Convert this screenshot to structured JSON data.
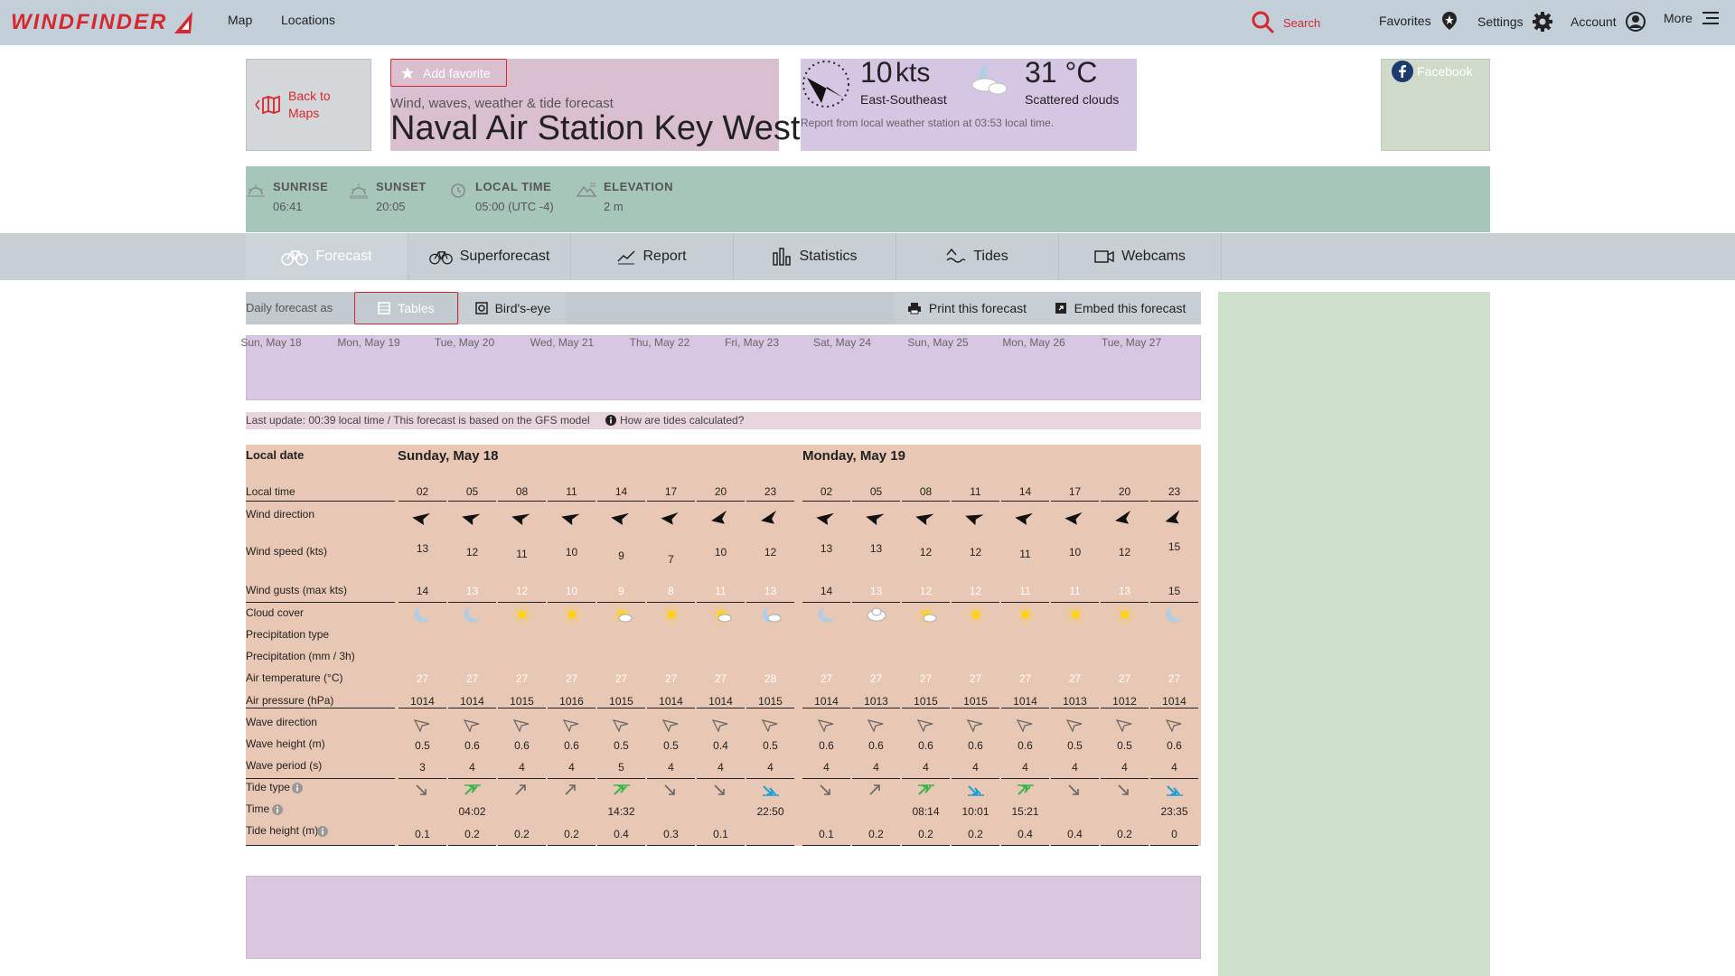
{
  "nav": {
    "logo": "WINDFINDER",
    "links": [
      "Map",
      "Locations"
    ],
    "search": "Search",
    "favorites": "Favorites",
    "settings": "Settings",
    "account": "Account",
    "more": "More"
  },
  "header": {
    "back": "Back to Maps",
    "add_favorite": "Add favorite",
    "subtitle": "Wind, waves, weather & tide forecast",
    "spot_name": "Naval Air Station Key West",
    "wind_value": "10",
    "wind_unit": "kts",
    "wind_dir": "East-Southeast",
    "temp": "31 °C",
    "cloud": "Scattered clouds",
    "report_note": "Report from local weather station at 03:53 local time.",
    "facebook": "Facebook"
  },
  "info": {
    "sunrise_label": "SUNRISE",
    "sunrise": "06:41",
    "sunset_label": "SUNSET",
    "sunset": "20:05",
    "localtime_label": "LOCAL TIME",
    "localtime": "05:00 (UTC -4)",
    "elevation_label": "ELEVATION",
    "elevation": "2 m"
  },
  "tabs": [
    "Forecast",
    "Superforecast",
    "Report",
    "Statistics",
    "Tides",
    "Webcams"
  ],
  "toolbar": {
    "daily_as": "Daily forecast as",
    "tables": "Tables",
    "birdseye": "Bird's-eye",
    "print": "Print this forecast",
    "embed": "Embed this forecast"
  },
  "days": [
    "Sun, May 18",
    "Mon, May 19",
    "Tue, May 20",
    "Wed, May 21",
    "Thu, May 22",
    "Fri, May 23",
    "Sat, May 24",
    "Sun, May 25",
    "Mon, May 26",
    "Tue, May 27"
  ],
  "note": {
    "last_update": "Last update: 00:39 local time / This forecast is based on the GFS model",
    "tides_calc": "How are tides calculated?"
  },
  "table": {
    "row_labels": {
      "local_date": "Local date",
      "local_time": "Local time",
      "wind_direction": "Wind direction",
      "wind_speed": "Wind speed (kts)",
      "wind_gusts": "Wind gusts (max kts)",
      "cloud_cover": "Cloud cover",
      "precip_type": "Precipitation type",
      "precip": "Precipitation (mm / 3h)",
      "air_temp": "Air temperature (°C)",
      "air_pressure": "Air pressure (hPa)",
      "wave_direction": "Wave direction",
      "wave_height": "Wave height (m)",
      "wave_period": "Wave period (s)",
      "tide_type": "Tide type",
      "tide_time": "Time",
      "tide_height": "Tide height (m)"
    },
    "day_titles": [
      "Sunday, May 18",
      "Monday, May 19"
    ],
    "times": [
      "02",
      "05",
      "08",
      "11",
      "14",
      "17",
      "20",
      "23",
      "02",
      "05",
      "08",
      "11",
      "14",
      "17",
      "20",
      "23"
    ],
    "wind_speed": [
      "13",
      "12",
      "11",
      "10",
      "9",
      "7",
      "10",
      "12",
      "13",
      "13",
      "12",
      "12",
      "11",
      "10",
      "12",
      "15"
    ],
    "wind_gusts": [
      "14",
      "13",
      "12",
      "10",
      "9",
      "8",
      "11",
      "13",
      "14",
      "13",
      "12",
      "12",
      "11",
      "11",
      "13",
      "15"
    ],
    "air_temp": [
      "27",
      "27",
      "27",
      "27",
      "27",
      "27",
      "27",
      "28",
      "27",
      "27",
      "27",
      "27",
      "27",
      "27",
      "27",
      "27"
    ],
    "air_pressure": [
      "1014",
      "1014",
      "1015",
      "1016",
      "1015",
      "1014",
      "1014",
      "1015",
      "1014",
      "1013",
      "1015",
      "1015",
      "1014",
      "1013",
      "1012",
      "1014"
    ],
    "wave_height": [
      "0.5",
      "0.6",
      "0.6",
      "0.6",
      "0.5",
      "0.5",
      "0.4",
      "0.5",
      "0.6",
      "0.6",
      "0.6",
      "0.6",
      "0.6",
      "0.5",
      "0.5",
      "0.6"
    ],
    "wave_period": [
      "3",
      "4",
      "4",
      "4",
      "5",
      "4",
      "4",
      "4",
      "4",
      "4",
      "4",
      "4",
      "4",
      "4",
      "4",
      "4"
    ],
    "tide_time": [
      "",
      "04:02",
      "",
      "",
      "14:32",
      "",
      "",
      "22:50",
      "",
      "",
      "08:14",
      "10:01",
      "15:21",
      "",
      "",
      "23:35"
    ],
    "tide_height": [
      "0.1",
      "0.2",
      "0.2",
      "0.2",
      "0.4",
      "0.3",
      "0.1",
      "",
      "0.1",
      "0.2",
      "0.2",
      "0.2",
      "0.4",
      "0.4",
      "0.2",
      "0"
    ],
    "cloud_icons": [
      "moon",
      "moon",
      "sun",
      "sun",
      "sun-cloud",
      "sun",
      "sun-cloud",
      "moon-cloud",
      "moon",
      "cloud",
      "sun-cloud",
      "sun",
      "sun",
      "sun",
      "sun",
      "moon"
    ],
    "tide_icons": [
      "falling",
      "high",
      "rising",
      "rising",
      "high",
      "falling",
      "falling",
      "low",
      "falling",
      "rising",
      "high",
      "low",
      "high",
      "falling",
      "falling",
      "low"
    ]
  }
}
